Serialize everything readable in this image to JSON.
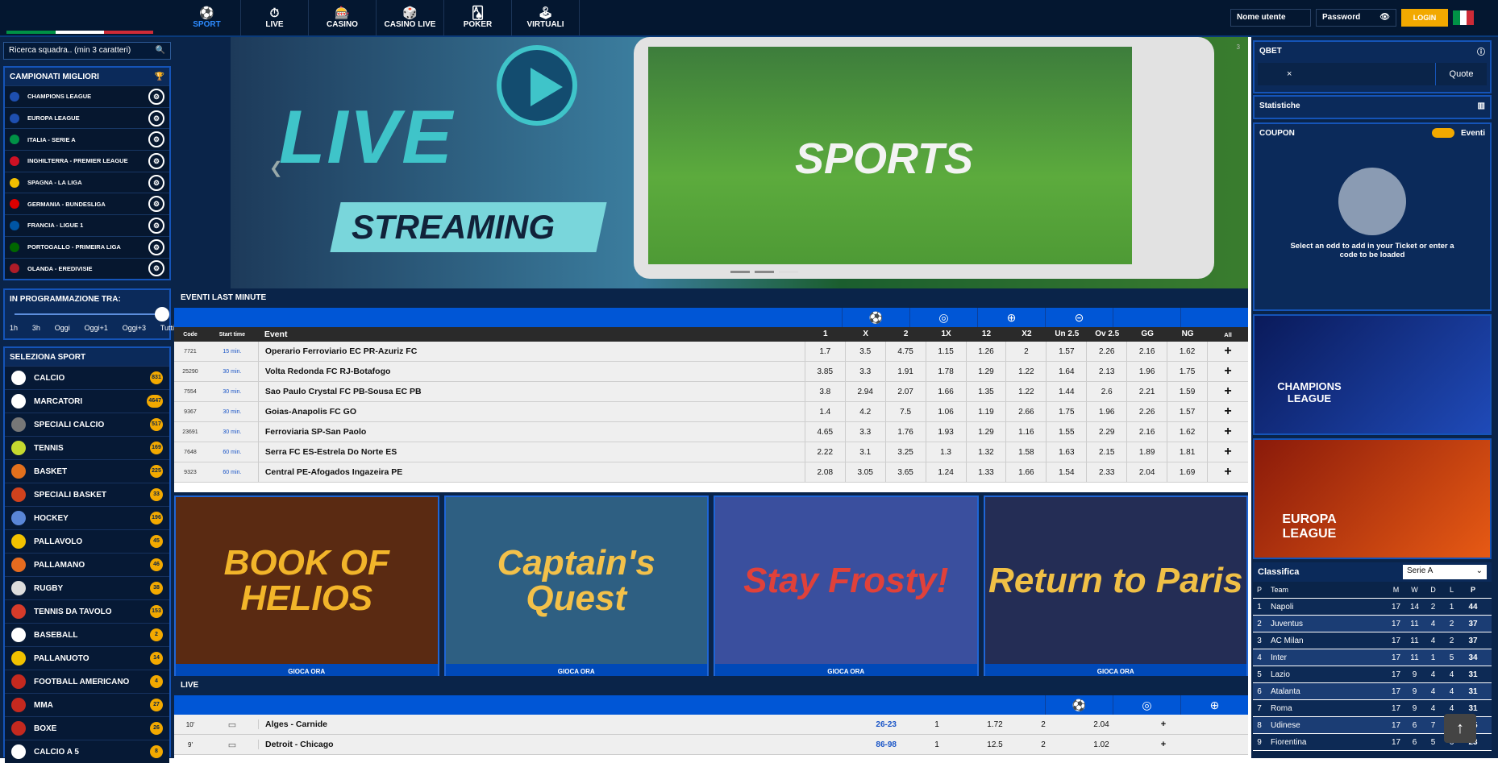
{
  "nav": {
    "items": [
      {
        "label": "SPORT",
        "icon": "soccer-ball-icon",
        "glyph": "⚽",
        "active": true
      },
      {
        "label": "LIVE",
        "icon": "stopwatch-icon",
        "glyph": "⏱"
      },
      {
        "label": "CASINO",
        "icon": "slot-machine-icon",
        "glyph": "🎰"
      },
      {
        "label": "CASINO LIVE",
        "icon": "live-dealer-icon",
        "glyph": "🎲"
      },
      {
        "label": "POKER",
        "icon": "cards-icon",
        "glyph": "🂡"
      },
      {
        "label": "VIRTUALI",
        "icon": "virtual-icon",
        "glyph": "🕹"
      }
    ]
  },
  "login": {
    "username_placeholder": "Nome utente",
    "password_placeholder": "Password",
    "login_label": "LOGIN"
  },
  "search": {
    "placeholder": "Ricerca squadra.. (min 3 caratteri)"
  },
  "championships": {
    "title": "CAMPIONATI MIGLIORI",
    "items": [
      {
        "label": "CHAMPIONS LEAGUE",
        "flag_color": "#1e4fb0"
      },
      {
        "label": "EUROPA LEAGUE",
        "flag_color": "#1e4fb0"
      },
      {
        "label": "ITALIA - SERIE A",
        "flag_color": "#009246"
      },
      {
        "label": "INGHILTERRA - PREMIER LEAGUE",
        "flag_color": "#ce1124"
      },
      {
        "label": "SPAGNA - LA LIGA",
        "flag_color": "#f1bf00"
      },
      {
        "label": "GERMANIA - BUNDESLIGA",
        "flag_color": "#dd0000"
      },
      {
        "label": "FRANCIA - LIGUE 1",
        "flag_color": "#0055a4"
      },
      {
        "label": "PORTOGALLO - PRIMEIRA LIGA",
        "flag_color": "#006600"
      },
      {
        "label": "OLANDA - EREDIVISIE",
        "flag_color": "#ae1c28"
      }
    ]
  },
  "schedule": {
    "title": "IN PROGRAMMAZIONE TRA:",
    "options": [
      "1h",
      "3h",
      "Oggi",
      "Oggi+1",
      "Oggi+3",
      "Tutti"
    ],
    "selected_fraction": 1.0
  },
  "sports": {
    "title": "SELEZIONA SPORT",
    "items": [
      {
        "label": "CALCIO",
        "count": "831",
        "color": "#ffffff"
      },
      {
        "label": "MARCATORI",
        "count": "4647",
        "color": "#ffffff"
      },
      {
        "label": "SPECIALI CALCIO",
        "count": "517",
        "color": "#777777"
      },
      {
        "label": "TENNIS",
        "count": "169",
        "color": "#c5d92f"
      },
      {
        "label": "BASKET",
        "count": "225",
        "color": "#e2701d"
      },
      {
        "label": "SPECIALI BASKET",
        "count": "33",
        "color": "#d0421d"
      },
      {
        "label": "HOCKEY",
        "count": "196",
        "color": "#5a86d6"
      },
      {
        "label": "PALLAVOLO",
        "count": "45",
        "color": "#f2c200"
      },
      {
        "label": "PALLAMANO",
        "count": "46",
        "color": "#e56b1f"
      },
      {
        "label": "RUGBY",
        "count": "38",
        "color": "#dddddd"
      },
      {
        "label": "TENNIS DA TAVOLO",
        "count": "153",
        "color": "#d63b2a"
      },
      {
        "label": "BASEBALL",
        "count": "2",
        "color": "#ffffff"
      },
      {
        "label": "PALLANUOTO",
        "count": "14",
        "color": "#f2c200"
      },
      {
        "label": "FOOTBALL AMERICANO",
        "count": "4",
        "color": "#c4291f"
      },
      {
        "label": "MMA",
        "count": "27",
        "color": "#c4291f"
      },
      {
        "label": "BOXE",
        "count": "26",
        "color": "#c4291f"
      },
      {
        "label": "CALCIO A 5",
        "count": "8",
        "color": "#ffffff"
      }
    ]
  },
  "banner": {
    "live": "LIVE",
    "streaming": "STREAMING",
    "sports": "SPORTS",
    "counter": "3"
  },
  "last_minute": {
    "title": "EVENTI LAST MINUTE",
    "tabs": [
      "⚽",
      "◎",
      "⊕",
      "⊝"
    ],
    "columns": [
      "Code",
      "Start time",
      "Event",
      "1",
      "X",
      "2",
      "1X",
      "12",
      "X2",
      "Un 2.5",
      "Ov 2.5",
      "GG",
      "NG",
      "All"
    ],
    "rows": [
      {
        "code": "7721",
        "time": "15 min.",
        "event": "Operario Ferroviario EC PR-Azuriz FC",
        "odds": [
          "1.7",
          "3.5",
          "4.75",
          "1.15",
          "1.26",
          "2",
          "1.57",
          "2.26",
          "2.16",
          "1.62"
        ]
      },
      {
        "code": "25290",
        "time": "30 min.",
        "event": "Volta Redonda FC RJ-Botafogo",
        "odds": [
          "3.85",
          "3.3",
          "1.91",
          "1.78",
          "1.29",
          "1.22",
          "1.64",
          "2.13",
          "1.96",
          "1.75"
        ]
      },
      {
        "code": "7554",
        "time": "30 min.",
        "event": "Sao Paulo Crystal FC PB-Sousa EC PB",
        "odds": [
          "3.8",
          "2.94",
          "2.07",
          "1.66",
          "1.35",
          "1.22",
          "1.44",
          "2.6",
          "2.21",
          "1.59"
        ]
      },
      {
        "code": "9367",
        "time": "30 min.",
        "event": "Goias-Anapolis FC GO",
        "odds": [
          "1.4",
          "4.2",
          "7.5",
          "1.06",
          "1.19",
          "2.66",
          "1.75",
          "1.96",
          "2.26",
          "1.57"
        ]
      },
      {
        "code": "23691",
        "time": "30 min.",
        "event": "Ferroviaria SP-San Paolo",
        "odds": [
          "4.65",
          "3.3",
          "1.76",
          "1.93",
          "1.29",
          "1.16",
          "1.55",
          "2.29",
          "2.16",
          "1.62"
        ]
      },
      {
        "code": "7648",
        "time": "60 min.",
        "event": "Serra FC ES-Estrela Do Norte ES",
        "odds": [
          "2.22",
          "3.1",
          "3.25",
          "1.3",
          "1.32",
          "1.58",
          "1.63",
          "2.15",
          "1.89",
          "1.81"
        ]
      },
      {
        "code": "9323",
        "time": "60 min.",
        "event": "Central PE-Afogados Ingazeira PE",
        "odds": [
          "2.08",
          "3.05",
          "3.65",
          "1.24",
          "1.33",
          "1.66",
          "1.54",
          "2.33",
          "2.04",
          "1.69"
        ]
      }
    ]
  },
  "games": [
    {
      "title": "BOOK OF HELIOS",
      "cta": "GIOCA ORA",
      "bg": "#5a2a12",
      "fg": "#f2b52a"
    },
    {
      "title": "Captain's Quest",
      "cta": "GIOCA ORA",
      "bg": "#2e5f82",
      "fg": "#f3c14a"
    },
    {
      "title": "Stay Frosty!",
      "cta": "GIOCA ORA",
      "bg": "#3a4f9e",
      "fg": "#e0413a"
    },
    {
      "title": "Return to Paris",
      "cta": "GIOCA ORA",
      "bg": "#242d55",
      "fg": "#f0c046"
    }
  ],
  "live": {
    "title": "LIVE",
    "rows": [
      {
        "minute": "10'",
        "event": "Alges - Carnide",
        "score": "26-23",
        "odds": [
          "1",
          "1.72",
          "2",
          "2.04"
        ]
      },
      {
        "minute": "9'",
        "event": "Detroit - Chicago",
        "score": "86-98",
        "odds": [
          "1",
          "12.5",
          "2",
          "1.02"
        ]
      }
    ]
  },
  "right": {
    "qbet": {
      "title": "QBET",
      "close": "×",
      "quote": "Quote"
    },
    "statistiche": "Statistiche",
    "coupon": {
      "title": "COUPON",
      "eventi": "Eventi",
      "empty_text": "Select an odd to add in your Ticket or enter a code to be loaded"
    },
    "promos": [
      "CHAMPIONS LEAGUE",
      "EUROPA LEAGUE"
    ],
    "classifica": {
      "title": "Classifica",
      "league": "Serie A",
      "columns": [
        "P",
        "Team",
        "M",
        "W",
        "D",
        "L",
        "P"
      ],
      "rows": [
        {
          "p": "1",
          "team": "Napoli",
          "m": "17",
          "w": "14",
          "d": "2",
          "l": "1",
          "pts": "44"
        },
        {
          "p": "2",
          "team": "Juventus",
          "m": "17",
          "w": "11",
          "d": "4",
          "l": "2",
          "pts": "37"
        },
        {
          "p": "3",
          "team": "AC Milan",
          "m": "17",
          "w": "11",
          "d": "4",
          "l": "2",
          "pts": "37"
        },
        {
          "p": "4",
          "team": "Inter",
          "m": "17",
          "w": "11",
          "d": "1",
          "l": "5",
          "pts": "34"
        },
        {
          "p": "5",
          "team": "Lazio",
          "m": "17",
          "w": "9",
          "d": "4",
          "l": "4",
          "pts": "31"
        },
        {
          "p": "6",
          "team": "Atalanta",
          "m": "17",
          "w": "9",
          "d": "4",
          "l": "4",
          "pts": "31"
        },
        {
          "p": "7",
          "team": "Roma",
          "m": "17",
          "w": "9",
          "d": "4",
          "l": "4",
          "pts": "31"
        },
        {
          "p": "8",
          "team": "Udinese",
          "m": "17",
          "w": "6",
          "d": "7",
          "l": "4",
          "pts": "25"
        },
        {
          "p": "9",
          "team": "Fiorentina",
          "m": "17",
          "w": "6",
          "d": "5",
          "l": "6",
          "pts": "23"
        }
      ]
    }
  }
}
